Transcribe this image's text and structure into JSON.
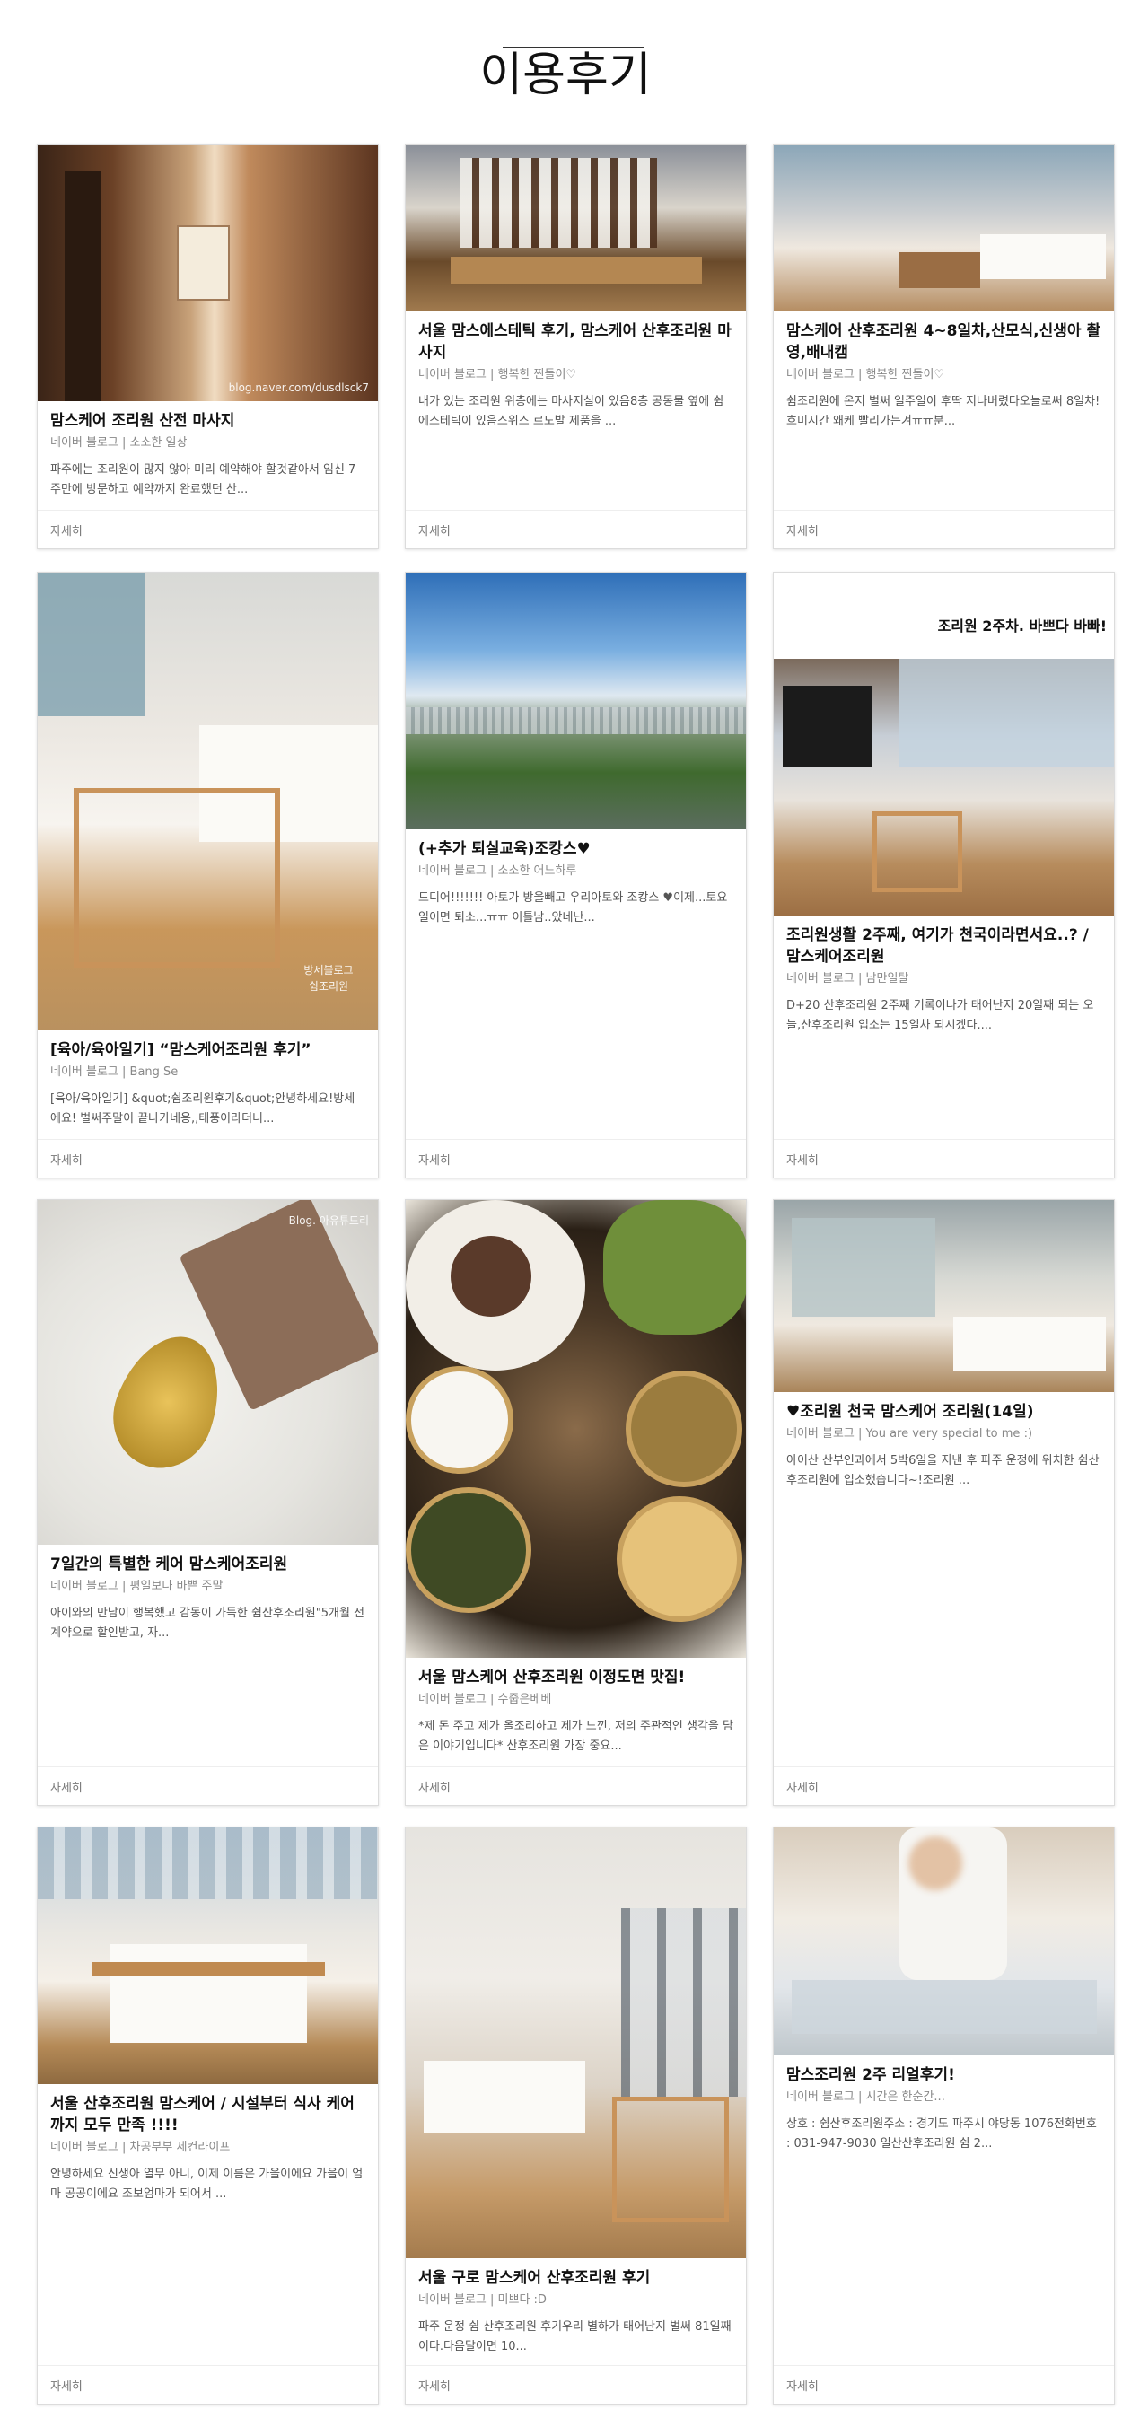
{
  "page": {
    "title": "이용후기"
  },
  "more_label": "자세히",
  "cards": [
    {
      "title": "맘스케어 조리원 산전 마사지",
      "meta": "네이버 블로그 | 소소한 일상",
      "excerpt": "파주에는 조리원이 많지 않아 미리 예약해야 할것같아서 임신 7주만에 방문하고 예약까지 완료했던 산...",
      "watermark": "blog.naver.com/dusdlsck7"
    },
    {
      "title": "서울 맘스에스테틱 후기, 맘스케어 산후조리원 마사지",
      "meta": "네이버 블로그 | 행복한 찐돌이♡",
      "excerpt": "내가 있는 조리원 위층에는 마사지실이 있음8층 공동물 옆에 쉼 에스테틱이 있음스위스 르노발 제품을 ..."
    },
    {
      "title": "맘스케어 산후조리원 4~8일차,산모식,신생아 촬영,배내캠",
      "meta": "네이버 블로그 | 행복한 찐돌이♡",
      "excerpt": "쉼조리원에 온지 벌써 일주일이 후딱 지나버렸다오늘로써 8일차! 흐미시간 왜케 빨리가는겨ㅠㅠ분..."
    },
    {
      "title": "[육아/육아일기] “맘스케어조리원 후기”",
      "meta": "네이버 블로그 | Bang Se",
      "excerpt": "[육아/육아일기] &quot;쉼조리원후기&quot;안녕하세요!방세에요! 벌써주말이 끝나가네용,,태풍이라더니...",
      "watermark": "방세블로그 쉼조리원"
    },
    {
      "title": "(+추가 퇴실교육)조캉스♥",
      "meta": "네이버 블로그 | 소소한 어느하루",
      "excerpt": "드디어!!!!!!! 아토가 방올빼고 우리아토와 조캉스 ♥이제...토요일이면 퇴소...ㅠㅠ 이틀남..았네난..."
    },
    {
      "title": "조리원생활 2주째, 여기가 천국이라면서요..? / 맘스케어조리원",
      "meta": "네이버 블로그 | 남만일탈",
      "excerpt": "D+20 산후조리원 2주째 기록이나가 태어난지 20일째 되는 오늘,산후조리원 입소는 15일차 되시겠다....",
      "toptext": "조리원 2주차. 바쁘다 바빠!"
    },
    {
      "title": "7일간의 특별한 케어 맘스케어조리원",
      "meta": "네이버 블로그 | 평일보다 바쁜 주말",
      "excerpt": " 아이와의 만남이 행복했고 감동이 가득한 쉼산후조리원\"5개월 전 계약으로 할인받고, 자...",
      "watermark": "Blog. 아유튜드리"
    },
    {
      "title": "서울 맘스케어 산후조리원 이정도면 맛집!",
      "meta": "네이버 블로그 | 수줍은베베",
      "excerpt": "*제 돈 주고 제가 올조리하고 제가 느낀, 저의 주관적인 생각을 담은 이야기입니다* 산후조리원 가장 중요..."
    },
    {
      "title": "♥조리원 천국 맘스케어 조리원(14일)",
      "meta": "네이버 블로그 | You are very special to me :)",
      "excerpt": "아이산 산부인과에서 5박6일을 지낸 후 파주 운정에 위치한 쉼산후조리원에 입소했습니다~!조리원 ..."
    },
    {
      "title": "서울 산후조리원 맘스케어 / 시설부터 식사 케어까지 모두 만족 !!!!",
      "meta": "네이버 블로그 | 차공부부 세컨라이프",
      "excerpt": "안녕하세요 신생아 열무 아니, 이제 이름은 가을이에요 가을이 엄마 공공이에요 조보엄마가 되어서 ..."
    },
    {
      "title": "서울 구로 맘스케어 산후조리원 후기",
      "meta": "네이버 블로그 | 미쁘다 :D",
      "excerpt": "파주 운정 쉼 산후조리원 후기우리 별하가 태어난지 벌써 81일째이다.다음달이면 10..."
    },
    {
      "title": "맘스조리원 2주 리얼후기!",
      "meta": "네이버 블로그 | 시간은 한순간...",
      "excerpt": "상호 : 쉼산후조리원주소 : 경기도 파주시 야당동 1076전화번호 : 031-947-9030 일산산후조리원 쉼 2..."
    }
  ]
}
